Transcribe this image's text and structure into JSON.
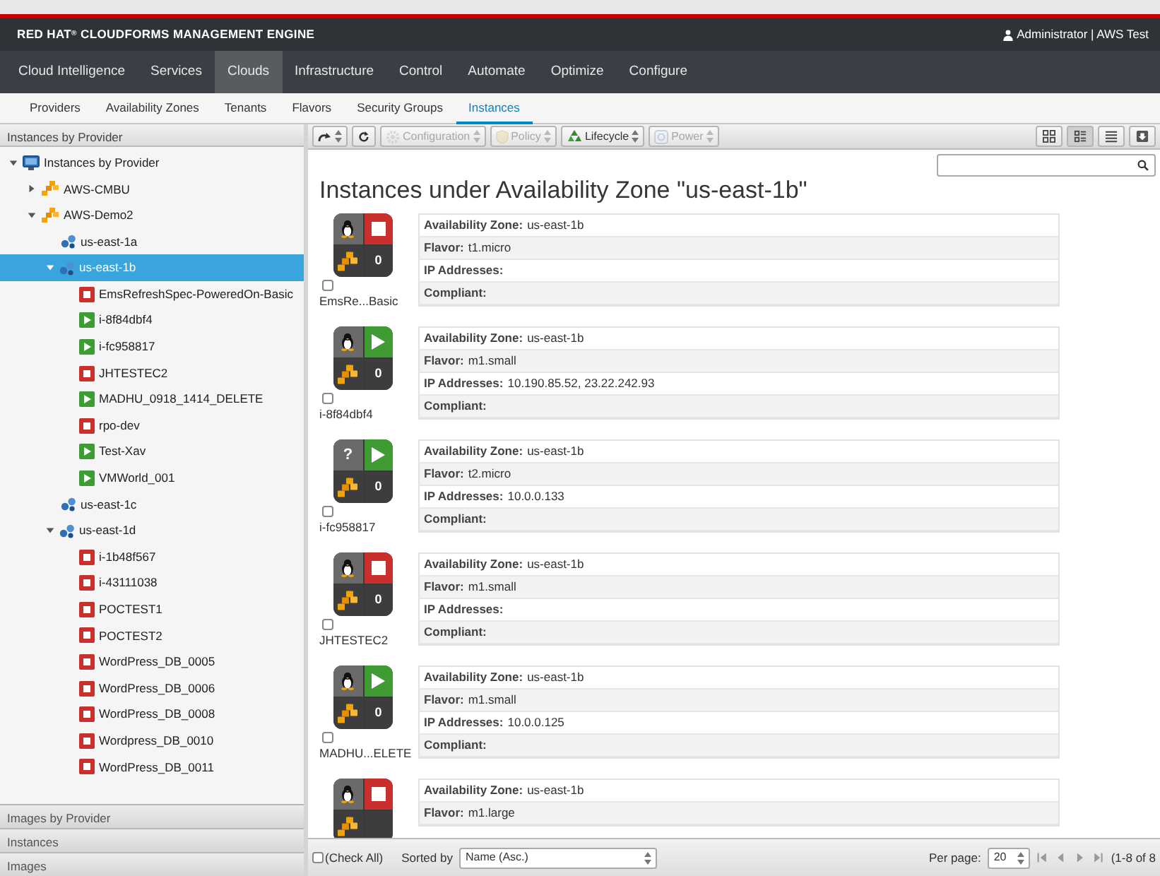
{
  "brand": {
    "name": "RED HAT",
    "mark": "®",
    "product": "CLOUDFORMS MANAGEMENT ENGINE"
  },
  "user": "Administrator | AWS Test",
  "main_nav": [
    {
      "label": "Cloud Intelligence",
      "selected": false
    },
    {
      "label": "Services",
      "selected": false
    },
    {
      "label": "Clouds",
      "selected": true
    },
    {
      "label": "Infrastructure",
      "selected": false
    },
    {
      "label": "Control",
      "selected": false
    },
    {
      "label": "Automate",
      "selected": false
    },
    {
      "label": "Optimize",
      "selected": false
    },
    {
      "label": "Configure",
      "selected": false
    }
  ],
  "sub_nav": [
    {
      "label": "Providers",
      "selected": false
    },
    {
      "label": "Availability Zones",
      "selected": false
    },
    {
      "label": "Tenants",
      "selected": false
    },
    {
      "label": "Flavors",
      "selected": false
    },
    {
      "label": "Security Groups",
      "selected": false
    },
    {
      "label": "Instances",
      "selected": true
    }
  ],
  "sidebar": {
    "title": "Instances by Provider",
    "tree": [
      {
        "label": "Instances by Provider",
        "kind": "root",
        "expanded": true,
        "selected": false,
        "children": [
          {
            "label": "AWS-CMBU",
            "kind": "provider",
            "expanded": false,
            "selected": false
          },
          {
            "label": "AWS-Demo2",
            "kind": "provider",
            "expanded": true,
            "selected": false,
            "children": [
              {
                "label": "us-east-1a",
                "kind": "zone",
                "selected": false
              },
              {
                "label": "us-east-1b",
                "kind": "zone",
                "expanded": true,
                "selected": true,
                "children": [
                  {
                    "label": "EmsRefreshSpec-PoweredOn-Basic",
                    "kind": "instance",
                    "powered_on": false,
                    "selected": false
                  },
                  {
                    "label": "i-8f84dbf4",
                    "kind": "instance",
                    "powered_on": true,
                    "selected": false
                  },
                  {
                    "label": "i-fc958817",
                    "kind": "instance",
                    "powered_on": true,
                    "selected": false
                  },
                  {
                    "label": "JHTESTEC2",
                    "kind": "instance",
                    "powered_on": false,
                    "selected": false
                  },
                  {
                    "label": "MADHU_0918_1414_DELETE",
                    "kind": "instance",
                    "powered_on": true,
                    "selected": false
                  },
                  {
                    "label": "rpo-dev",
                    "kind": "instance",
                    "powered_on": false,
                    "selected": false
                  },
                  {
                    "label": "Test-Xav",
                    "kind": "instance",
                    "powered_on": true,
                    "selected": false
                  },
                  {
                    "label": "VMWorld_001",
                    "kind": "instance",
                    "powered_on": true,
                    "selected": false
                  }
                ]
              },
              {
                "label": "us-east-1c",
                "kind": "zone",
                "selected": false
              },
              {
                "label": "us-east-1d",
                "kind": "zone",
                "expanded": true,
                "selected": false,
                "children": [
                  {
                    "label": "i-1b48f567",
                    "kind": "instance",
                    "powered_on": false,
                    "selected": false
                  },
                  {
                    "label": "i-43111038",
                    "kind": "instance",
                    "powered_on": false,
                    "selected": false
                  },
                  {
                    "label": "POCTEST1",
                    "kind": "instance",
                    "powered_on": false,
                    "selected": false
                  },
                  {
                    "label": "POCTEST2",
                    "kind": "instance",
                    "powered_on": false,
                    "selected": false
                  },
                  {
                    "label": "WordPress_DB_0005",
                    "kind": "instance",
                    "powered_on": false,
                    "selected": false
                  },
                  {
                    "label": "WordPress_DB_0006",
                    "kind": "instance",
                    "powered_on": false,
                    "selected": false
                  },
                  {
                    "label": "WordPress_DB_0008",
                    "kind": "instance",
                    "powered_on": false,
                    "selected": false
                  },
                  {
                    "label": "Wordpress_DB_0010",
                    "kind": "instance",
                    "powered_on": false,
                    "selected": false
                  },
                  {
                    "label": "WordPress_DB_0011",
                    "kind": "instance",
                    "powered_on": false,
                    "selected": false
                  }
                ]
              }
            ]
          }
        ]
      }
    ],
    "accordions": [
      {
        "label": "Images by Provider"
      },
      {
        "label": "Instances"
      },
      {
        "label": "Images"
      }
    ]
  },
  "toolbar": {
    "buttons": [
      {
        "kind": "history",
        "disabled": false
      },
      {
        "kind": "refresh",
        "disabled": false
      },
      {
        "kind": "configuration",
        "label": "Configuration",
        "disabled": true
      },
      {
        "kind": "policy",
        "label": "Policy",
        "disabled": true
      },
      {
        "kind": "lifecycle",
        "label": "Lifecycle",
        "disabled": false
      },
      {
        "kind": "power",
        "label": "Power",
        "disabled": true
      }
    ],
    "views": [
      {
        "kind": "grid",
        "selected": false
      },
      {
        "kind": "tile",
        "selected": true
      },
      {
        "kind": "list",
        "selected": false
      },
      {
        "kind": "download",
        "selected": false
      }
    ]
  },
  "title": "Instances under Availability Zone \"us-east-1b\"",
  "instances": [
    {
      "name": "EmsRe...Basic",
      "kind": "linux",
      "powered_on": false,
      "count": "0",
      "checked": false,
      "fields": [
        {
          "label": "Availability Zone:",
          "value": "us-east-1b"
        },
        {
          "label": "Flavor:",
          "value": "t1.micro"
        },
        {
          "label": "IP Addresses:"
        },
        {
          "label": "Compliant:"
        }
      ]
    },
    {
      "name": "i-8f84dbf4",
      "kind": "linux",
      "powered_on": true,
      "count": "0",
      "checked": false,
      "fields": [
        {
          "label": "Availability Zone:",
          "value": "us-east-1b"
        },
        {
          "label": "Flavor:",
          "value": "m1.small"
        },
        {
          "label": "IP Addresses:",
          "value": "10.190.85.52, 23.22.242.93"
        },
        {
          "label": "Compliant:"
        }
      ]
    },
    {
      "name": "i-fc958817",
      "kind": "unknown",
      "os_glyph": "?",
      "powered_on": true,
      "count": "0",
      "checked": false,
      "fields": [
        {
          "label": "Availability Zone:",
          "value": "us-east-1b"
        },
        {
          "label": "Flavor:",
          "value": "t2.micro"
        },
        {
          "label": "IP Addresses:",
          "value": "10.0.0.133"
        },
        {
          "label": "Compliant:"
        }
      ]
    },
    {
      "name": "JHTESTEC2",
      "kind": "linux",
      "powered_on": false,
      "count": "0",
      "checked": false,
      "fields": [
        {
          "label": "Availability Zone:",
          "value": "us-east-1b"
        },
        {
          "label": "Flavor:",
          "value": "m1.small"
        },
        {
          "label": "IP Addresses:"
        },
        {
          "label": "Compliant:"
        }
      ]
    },
    {
      "name": "MADHU...ELETE",
      "kind": "linux",
      "powered_on": true,
      "count": "0",
      "checked": false,
      "fields": [
        {
          "label": "Availability Zone:",
          "value": "us-east-1b"
        },
        {
          "label": "Flavor:",
          "value": "m1.small"
        },
        {
          "label": "IP Addresses:",
          "value": "10.0.0.125"
        },
        {
          "label": "Compliant:"
        }
      ]
    },
    {
      "kind": "linux",
      "powered_on": false,
      "fields": [
        {
          "label": "Availability Zone:",
          "value": "us-east-1b"
        },
        {
          "label": "Flavor:",
          "value": "m1.large"
        }
      ]
    }
  ],
  "footer": {
    "check_all": {
      "label": "(Check All)",
      "checked": false
    },
    "sort_label": "Sorted by",
    "sort_value": "Name (Asc.)",
    "per_page_label": "Per page:",
    "per_page_value": "20",
    "range": "(1-8 of 8"
  }
}
